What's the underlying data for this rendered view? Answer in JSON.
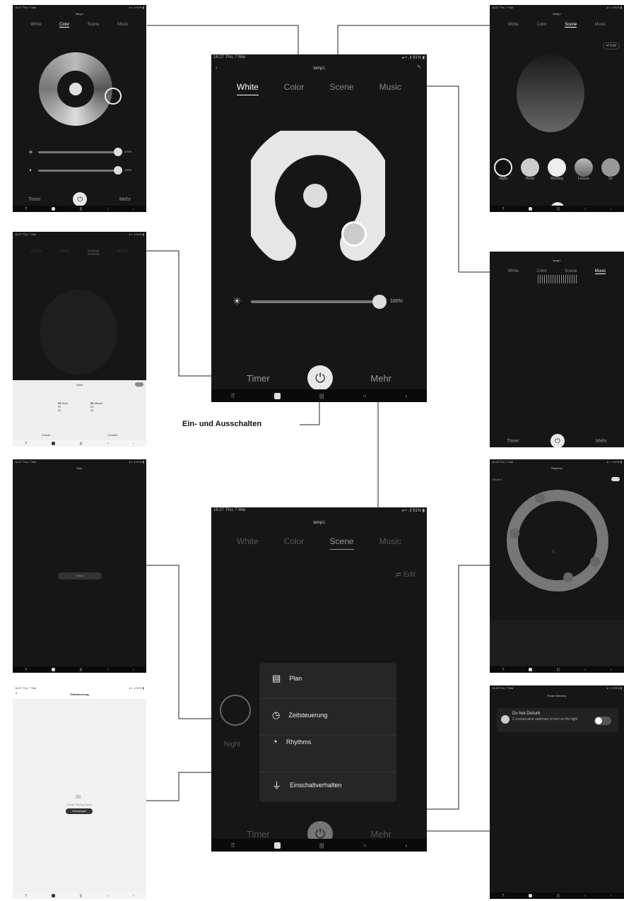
{
  "status": {
    "time_date": "16:27  Thu, 7 Mar",
    "battery": "◂ ≈ .il 91% ▮",
    "time_small": "16:27  Thu, 7 Mar",
    "time_b": "16:28  Thu, 7 Mar"
  },
  "device_title": "lamp1",
  "tabs": [
    "White",
    "Color",
    "Scene",
    "Music"
  ],
  "bottom": {
    "timer": "Timer",
    "more": "Mehr"
  },
  "main": {
    "brightness": "100%"
  },
  "color": {
    "bright1": "100%",
    "bright2": "100%"
  },
  "scene": {
    "edit": "⇄ Edit",
    "items": [
      "Night",
      "Read",
      "Working",
      "Leisure",
      "Se"
    ]
  },
  "timer_sheet": {
    "title": "Timer",
    "hour_label": "Hour",
    "minute_label": "Minute",
    "hours": [
      "00",
      "01",
      "02"
    ],
    "minutes": [
      "00",
      "01",
      "02"
    ],
    "cancel": "Cancel",
    "confirm": "Confirm"
  },
  "plan": {
    "title": "Plan",
    "button": "Hinzu"
  },
  "zeit": {
    "title": "Zeitsteuerung",
    "empty": "Keine Timing-Daten",
    "add": "Hinzufügen"
  },
  "rhythms": {
    "title": "Rhythms",
    "row": "Rhythm"
  },
  "power_memory": {
    "title": "Power Memory",
    "dnd": "Do Not Disturb",
    "dnd_desc": "2 consecutive switches to turn on the light"
  },
  "menu": {
    "items": [
      "Plan",
      "Zeitsteuerung",
      "Rhythms",
      "Einschaltverhalten"
    ]
  },
  "annotation": "Ein- und Ausschalten",
  "scene_main": {
    "night": "Night",
    "se": "S"
  }
}
